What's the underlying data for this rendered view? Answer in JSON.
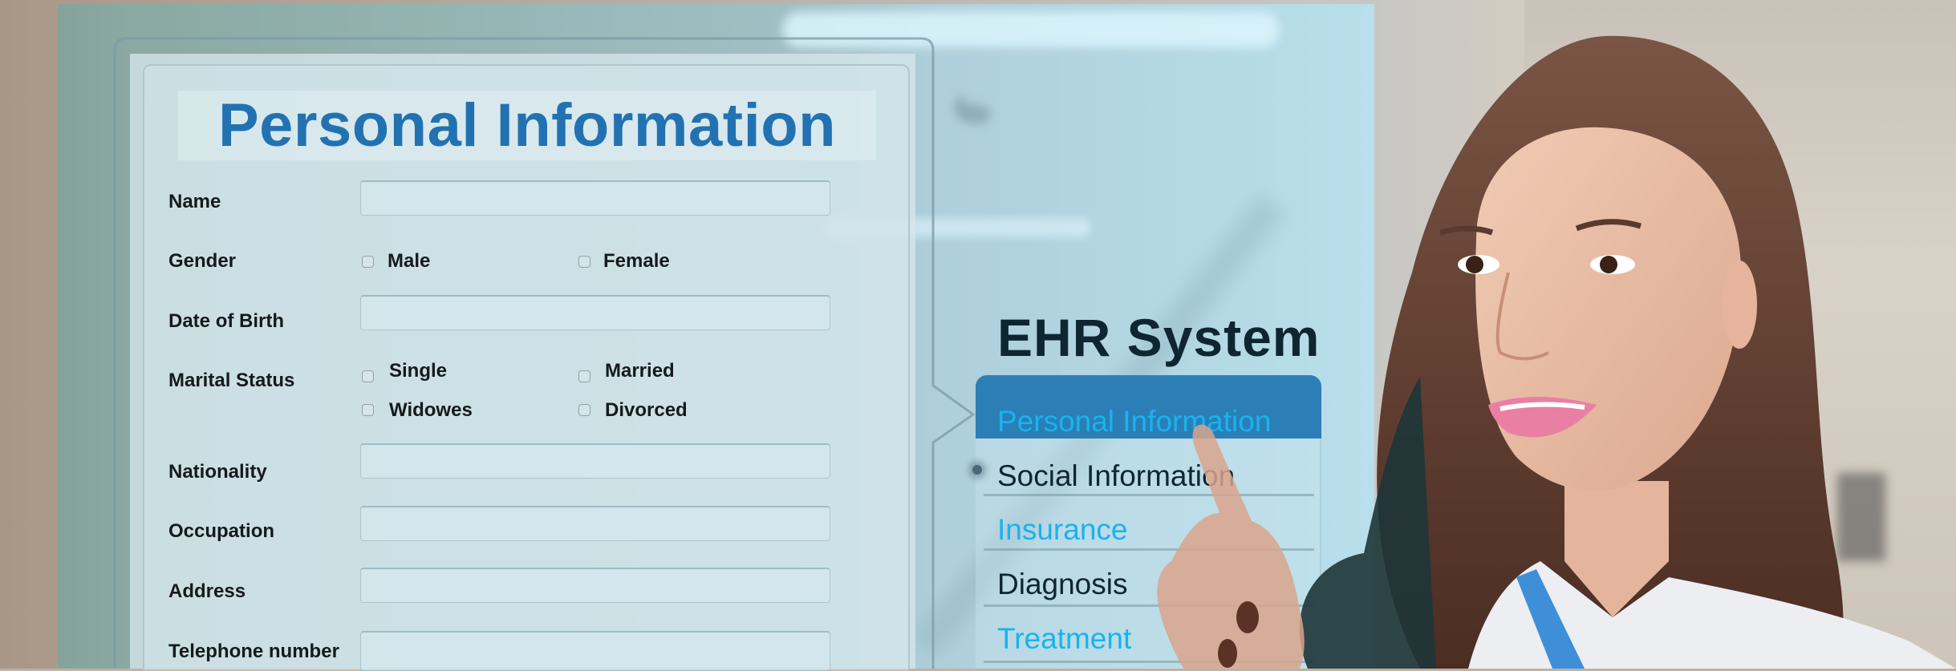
{
  "form": {
    "title": "Personal Information",
    "fields": [
      {
        "label": "Name",
        "type": "text",
        "value": ""
      },
      {
        "label": "Gender",
        "type": "checkbox-group",
        "options": [
          {
            "label": "Male",
            "checked": false
          },
          {
            "label": "Female",
            "checked": false
          }
        ]
      },
      {
        "label": "Date of Birth",
        "type": "text",
        "value": ""
      },
      {
        "label": "Marital Status",
        "type": "checkbox-group",
        "options": [
          {
            "label": "Single",
            "checked": false
          },
          {
            "label": "Married",
            "checked": false
          },
          {
            "label": "Widowes",
            "checked": false
          },
          {
            "label": "Divorced",
            "checked": false
          }
        ]
      },
      {
        "label": "Nationality",
        "type": "text",
        "value": ""
      },
      {
        "label": "Occupation",
        "type": "text",
        "value": ""
      },
      {
        "label": "Address",
        "type": "text",
        "value": ""
      },
      {
        "label": "Telephone number",
        "type": "text",
        "value": ""
      }
    ]
  },
  "ehr": {
    "title": "EHR System",
    "selected_index": 0,
    "items": [
      {
        "label": "Personal Information",
        "selected": true
      },
      {
        "label": "Social Information",
        "selected": false
      },
      {
        "label": "Insurance",
        "selected": false
      },
      {
        "label": "Diagnosis",
        "selected": false
      },
      {
        "label": "Treatment",
        "selected": false
      }
    ]
  },
  "colors": {
    "form_title": "#2272b2",
    "menu_selected_bg": "#2b7fb6",
    "menu_accent_text": "#19b3ee",
    "menu_dark_text": "#0f2630",
    "ehr_title": "#0e2631"
  },
  "scene": {
    "subject": "female doctor in white coat touching virtual screen"
  }
}
